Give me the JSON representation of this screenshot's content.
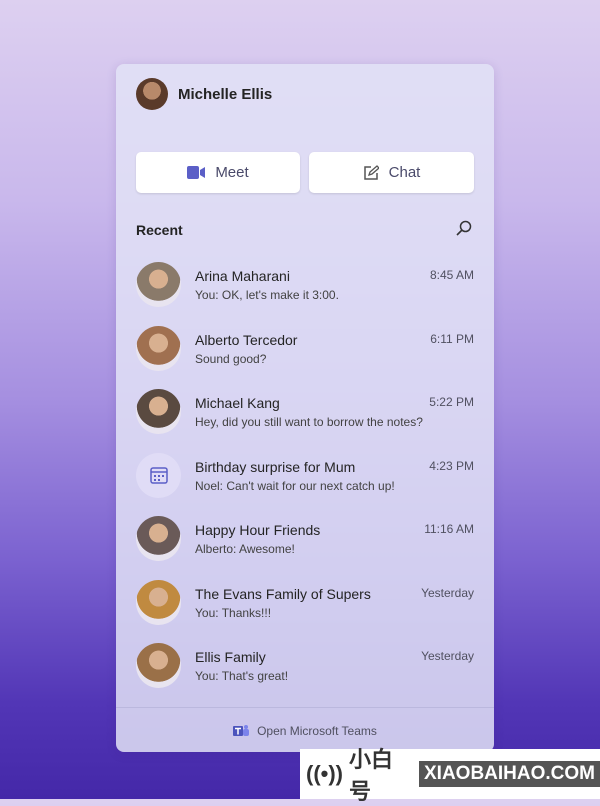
{
  "user": {
    "name": "Michelle Ellis"
  },
  "actions": {
    "meet": "Meet",
    "chat": "Chat"
  },
  "recent": {
    "title": "Recent"
  },
  "chats": [
    {
      "name": "Arina Maharani",
      "message": "You: OK, let's make it 3:00.",
      "time": "8:45 AM",
      "avatar": "#8a7a6a"
    },
    {
      "name": "Alberto Tercedor",
      "message": "Sound good?",
      "time": "6:11 PM",
      "avatar": "#a07050"
    },
    {
      "name": "Michael Kang",
      "message": "Hey, did you still want to borrow the notes?",
      "time": "5:22 PM",
      "avatar": "#5a4a40"
    },
    {
      "name": "Birthday surprise for Mum",
      "message": "Noel: Can't wait for our next catch up!",
      "time": "4:23 PM",
      "avatar": "calendar-icon"
    },
    {
      "name": "Happy Hour Friends",
      "message": "Alberto: Awesome!",
      "time": "11:16 AM",
      "avatar": "#6a5a58"
    },
    {
      "name": "The Evans Family of Supers",
      "message": "You: Thanks!!!",
      "time": "Yesterday",
      "avatar": "#c08a40"
    },
    {
      "name": "Ellis Family",
      "message": "You: That's great!",
      "time": "Yesterday",
      "avatar": "#9a7048"
    }
  ],
  "footer": {
    "open_teams": "Open Microsoft Teams"
  },
  "watermark": {
    "brand": "小白号",
    "site": "XIAOBAIHAO.COM"
  },
  "colors": {
    "accent": "#5b5fc7"
  }
}
